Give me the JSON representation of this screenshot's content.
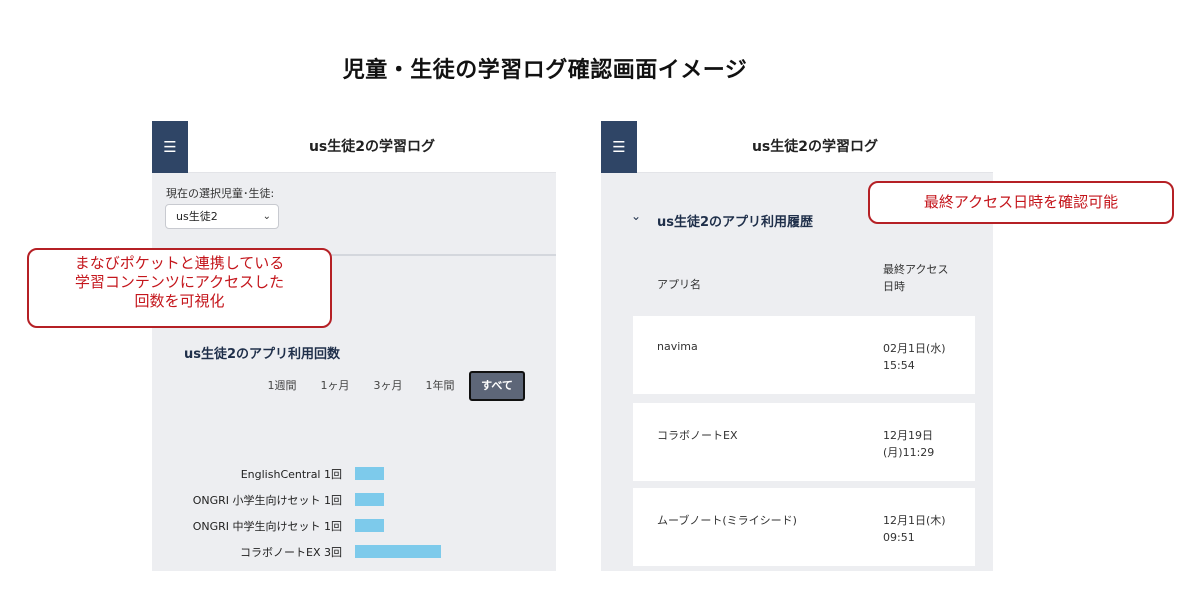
{
  "page_title": "児童・生徒の学習ログ確認画面イメージ",
  "left_panel": {
    "menu_icon": "hamburger-icon",
    "header_title": "us生徒2の学習ログ",
    "select_label": "現在の選択児童･生徒:",
    "select_value": "us生徒2",
    "section_title": "us生徒2のアプリ利用回数",
    "periods": [
      "1週間",
      "1ヶ月",
      "3ヶ月",
      "1年間",
      "すべて"
    ],
    "active_period": "すべて",
    "chart_data": {
      "type": "bar",
      "orientation": "horizontal",
      "categories": [
        "EnglishCentral",
        "ONGRI 小学生向けセット",
        "ONGRI 中学生向けセット",
        "コラボノートEX"
      ],
      "value_labels": [
        "1回",
        "1回",
        "1回",
        "3回"
      ],
      "values": [
        1,
        1,
        1,
        3
      ],
      "bar_color": "#7dcaeb"
    }
  },
  "right_panel": {
    "menu_icon": "hamburger-icon",
    "header_title": "us生徒2の学習ログ",
    "section_title": "us生徒2のアプリ利用履歴",
    "col_app": "アプリ名",
    "col_last_access_1": "最終アクセス",
    "col_last_access_2": "日時",
    "rows": [
      {
        "name": "navima",
        "time_1": "02月1日(水)",
        "time_2": "15:54"
      },
      {
        "name": "コラボノートEX",
        "time_1": "12月19日",
        "time_2": "(月)11:29"
      },
      {
        "name": "ムーブノート(ミライシード)",
        "time_1": "12月1日(木)",
        "time_2": "09:51"
      }
    ]
  },
  "callout_left": {
    "line1": "まなびポケットと連携している",
    "line2": "学習コンテンツにアクセスした",
    "line3": "回数を可視化"
  },
  "callout_right": {
    "text": "最終アクセス日時を確認可能"
  },
  "colors": {
    "accent_navy": "#2f4566",
    "callout_red": "#c4161c",
    "bar_blue": "#7dcaeb"
  }
}
